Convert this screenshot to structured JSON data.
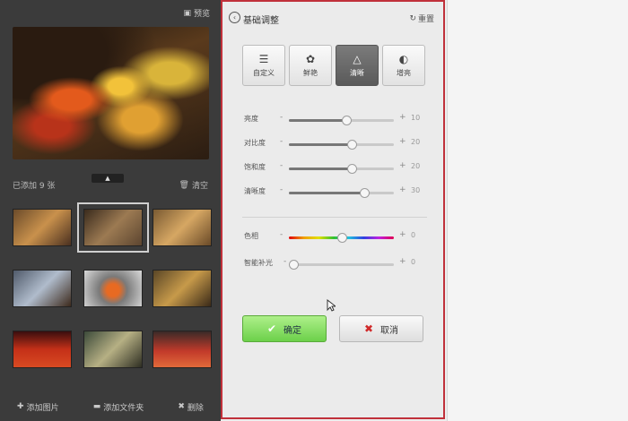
{
  "left_panel": {
    "preview_label": "预览",
    "added_text": "已添加 9 张",
    "clear_label": "清空",
    "collapse_glyph": "▲",
    "footer": {
      "add_image": "添加图片",
      "add_folder": "添加文件夹",
      "delete": "删除"
    }
  },
  "adjust_panel": {
    "title": "基础调整",
    "reset_label": "重置",
    "modes": [
      {
        "label": "自定义",
        "icon": "sliders-icon"
      },
      {
        "label": "鲜艳",
        "icon": "flower-icon"
      },
      {
        "label": "清晰",
        "icon": "triangle-icon"
      },
      {
        "label": "增亮",
        "icon": "half-circle-icon"
      }
    ],
    "active_mode": "清晰",
    "sliders": [
      {
        "label": "亮度",
        "value": "10",
        "level": 0.55
      },
      {
        "label": "对比度",
        "value": "20",
        "level": 0.6
      },
      {
        "label": "饱和度",
        "value": "20",
        "level": 0.6
      },
      {
        "label": "清晰度",
        "value": "30",
        "level": 0.72
      }
    ],
    "color_sliders": [
      {
        "label": "色相",
        "value": "0",
        "level": 0.5,
        "kind": "hue"
      },
      {
        "label": "智能补光",
        "value": "0",
        "level": 0.04,
        "kind": "plain"
      }
    ],
    "ok_label": "确定",
    "cancel_label": "取消"
  }
}
